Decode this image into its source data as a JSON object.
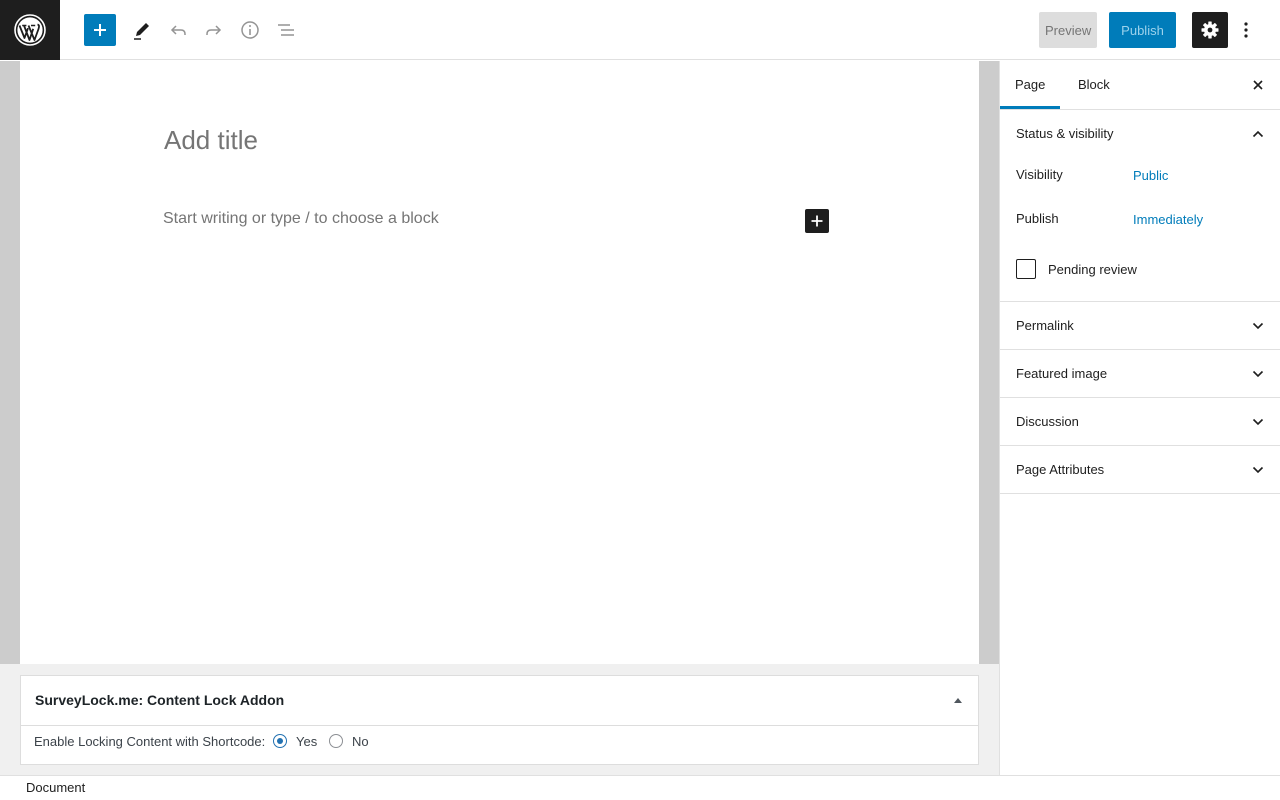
{
  "toolbar": {
    "preview_label": "Preview",
    "publish_label": "Publish"
  },
  "editor": {
    "title_placeholder": "Add title",
    "block_placeholder": "Start writing or type / to choose a block"
  },
  "metabox": {
    "title": "SurveyLock.me: Content Lock Addon",
    "shortcode_label": "Enable Locking Content with Shortcode:",
    "options": [
      "Yes",
      "No"
    ],
    "selected": "Yes"
  },
  "sidebar": {
    "tabs": [
      "Page",
      "Block"
    ],
    "active_tab": "Page",
    "status_panel": {
      "title": "Status & visibility",
      "visibility_label": "Visibility",
      "visibility_value": "Public",
      "publish_label": "Publish",
      "publish_value": "Immediately",
      "pending_label": "Pending review"
    },
    "panels": [
      "Permalink",
      "Featured image",
      "Discussion",
      "Page Attributes"
    ]
  },
  "footer": {
    "breadcrumb": "Document"
  },
  "colors": {
    "accent": "#007cba",
    "dark": "#1e1e1e"
  },
  "icons": [
    "wordpress-logo-icon",
    "plus-icon",
    "pencil-icon",
    "undo-icon",
    "redo-icon",
    "info-icon",
    "list-view-icon",
    "gear-icon",
    "more-vertical-icon",
    "close-icon",
    "chevron-up-icon",
    "chevron-down-icon",
    "triangle-up-icon"
  ]
}
